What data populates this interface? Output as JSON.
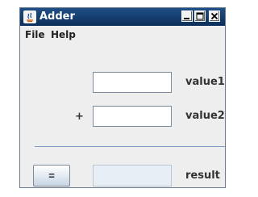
{
  "window": {
    "title": "Adder",
    "app_icon": "java-icon",
    "controls": [
      "minimize-icon",
      "maximize-icon",
      "close-icon"
    ]
  },
  "menubar": {
    "items": [
      {
        "label": "File"
      },
      {
        "label": "Help"
      }
    ]
  },
  "form": {
    "value1": {
      "label": "value1",
      "value": ""
    },
    "operator": "+",
    "value2": {
      "label": "value2",
      "value": ""
    },
    "equals_label": "=",
    "result": {
      "label": "result",
      "value": ""
    }
  },
  "colors": {
    "titlebar": "#0b2f5a",
    "window_bg": "#eeeeee",
    "separator": "#7f9cc4",
    "button_gradient_bottom": "#c8d6e6"
  }
}
